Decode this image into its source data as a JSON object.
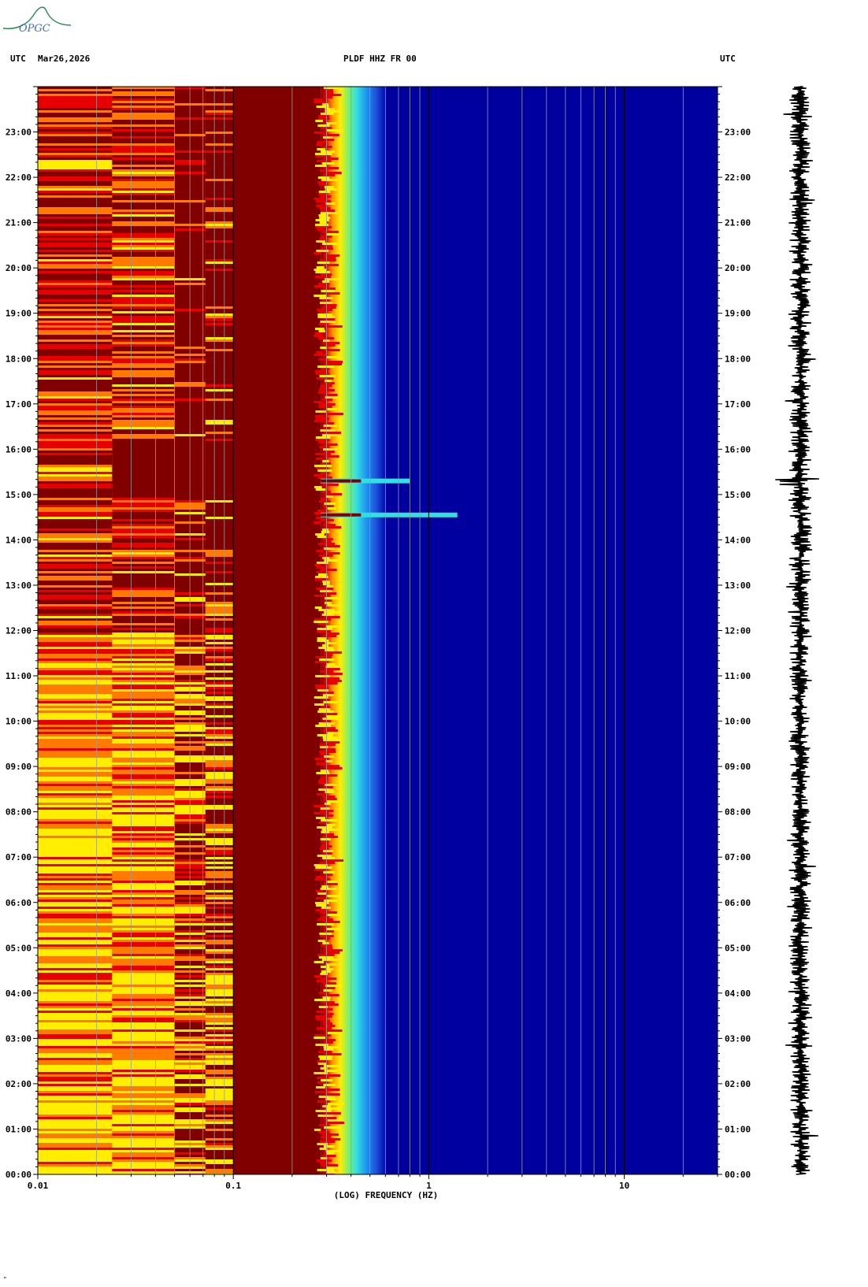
{
  "header": {
    "utc_left": "UTC",
    "date": "Mar26,2026",
    "station": "PLDF HHZ FR 00",
    "utc_right": "UTC"
  },
  "logo": {
    "text": "OPGC",
    "color": "#2e8b57"
  },
  "footer_mark": "\"",
  "colors": {
    "dark_red": "#800000",
    "red": "#e60000",
    "orange": "#ff7a00",
    "yellow": "#ffee00",
    "cyan": "#33e0e0",
    "blue": "#1e50d8",
    "dark_blue": "#00009e"
  },
  "chart_data": {
    "type": "heatmap",
    "title": "PLDF HHZ FR 00",
    "xlabel": "(LOG) FREQUENCY (HZ)",
    "ylabel": "UTC",
    "x_scale": "log",
    "xlim": [
      0.01,
      30
    ],
    "x_ticks": [
      {
        "value": 0.01,
        "label": "0.01"
      },
      {
        "value": 0.1,
        "label": "0.1"
      },
      {
        "value": 1,
        "label": "1"
      },
      {
        "value": 10,
        "label": "10"
      }
    ],
    "y_ticks": [
      "00:00",
      "01:00",
      "02:00",
      "03:00",
      "04:00",
      "05:00",
      "06:00",
      "07:00",
      "08:00",
      "09:00",
      "10:00",
      "11:00",
      "12:00",
      "13:00",
      "14:00",
      "15:00",
      "16:00",
      "17:00",
      "18:00",
      "19:00",
      "20:00",
      "21:00",
      "22:00",
      "23:00"
    ],
    "ylim_hours": [
      0,
      24
    ],
    "frequency_bands": [
      {
        "f_min": 0.01,
        "f_max": 0.1,
        "dominant": "yellow/orange/red striping (high power)"
      },
      {
        "f_min": 0.1,
        "f_max": 0.28,
        "dominant": "dark red (peak power)"
      },
      {
        "f_min": 0.28,
        "f_max": 0.6,
        "dominant": "transition yellow to cyan to blue (microseism edge)"
      },
      {
        "f_min": 0.6,
        "f_max": 30,
        "dominant": "dark blue (low power)"
      }
    ],
    "events_hours_utc": [
      14.55,
      15.3
    ],
    "seismogram": "trace of vertical component alongside spectrogram"
  }
}
